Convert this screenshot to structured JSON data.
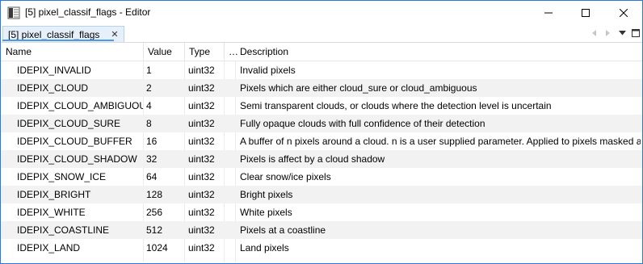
{
  "window": {
    "title": "[5] pixel_classif_flags - Editor"
  },
  "tab": {
    "label": "[5] pixel_classif_flags",
    "close_glyph": "✕"
  },
  "table": {
    "headers": {
      "name": "Name",
      "value": "Value",
      "type": "Type",
      "dots": "…",
      "description": "Description"
    },
    "rows": [
      {
        "name": "IDEPIX_INVALID",
        "value": "1",
        "type": "uint32",
        "description": "Invalid pixels"
      },
      {
        "name": "IDEPIX_CLOUD",
        "value": "2",
        "type": "uint32",
        "description": "Pixels which are either cloud_sure or cloud_ambiguous"
      },
      {
        "name": "IDEPIX_CLOUD_AMBIGUOUS",
        "value": "4",
        "type": "uint32",
        "description": "Semi transparent clouds, or clouds where the detection level is uncertain"
      },
      {
        "name": "IDEPIX_CLOUD_SURE",
        "value": "8",
        "type": "uint32",
        "description": "Fully opaque clouds with full confidence of their detection"
      },
      {
        "name": "IDEPIX_CLOUD_BUFFER",
        "value": "16",
        "type": "uint32",
        "description": "A buffer of n pixels around a cloud. n is a user supplied parameter. Applied to pixels masked as 'cloud'"
      },
      {
        "name": "IDEPIX_CLOUD_SHADOW",
        "value": "32",
        "type": "uint32",
        "description": "Pixels is affect by a cloud shadow"
      },
      {
        "name": "IDEPIX_SNOW_ICE",
        "value": "64",
        "type": "uint32",
        "description": "Clear snow/ice pixels"
      },
      {
        "name": "IDEPIX_BRIGHT",
        "value": "128",
        "type": "uint32",
        "description": "Bright pixels"
      },
      {
        "name": "IDEPIX_WHITE",
        "value": "256",
        "type": "uint32",
        "description": "White pixels"
      },
      {
        "name": "IDEPIX_COASTLINE",
        "value": "512",
        "type": "uint32",
        "description": "Pixels at a coastline"
      },
      {
        "name": "IDEPIX_LAND",
        "value": "1024",
        "type": "uint32",
        "description": "Land pixels"
      }
    ]
  },
  "icons": {
    "app": "editor-app-icon",
    "minimize": "minimize-icon",
    "maximize": "maximize-icon",
    "close": "close-icon",
    "tab_left": "chevron-left-icon",
    "tab_right": "chevron-right-icon",
    "tab_menu": "dropdown-icon",
    "tab_maximize": "maximize-view-icon"
  },
  "colors": {
    "window_border": "#2b79d7",
    "tab_active_bg": "#e6f0fa",
    "tab_underline": "#4d9be6",
    "row_alt": "#f2f2f2"
  }
}
